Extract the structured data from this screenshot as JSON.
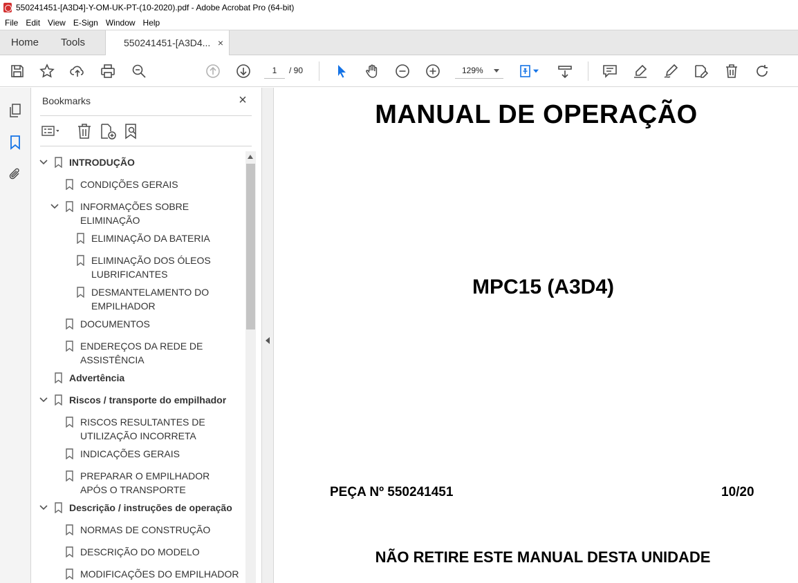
{
  "window": {
    "title": "550241451-[A3D4]-Y-OM-UK-PT-(10-2020).pdf - Adobe Acrobat Pro (64-bit)"
  },
  "menu": [
    "File",
    "Edit",
    "View",
    "E-Sign",
    "Window",
    "Help"
  ],
  "tabs": {
    "home": "Home",
    "tools": "Tools",
    "document": "550241451-[A3D4...",
    "close": "×"
  },
  "toolbar": {
    "page_current": "1",
    "page_total": "/ 90",
    "zoom": "129%",
    "icons": [
      "save-icon",
      "star-icon",
      "upload-icon",
      "print-icon",
      "search-icon",
      "page-up-icon",
      "page-down-icon",
      "select-cursor-icon",
      "hand-icon",
      "zoom-out-icon",
      "zoom-in-icon",
      "fit-page-icon",
      "scroll-mode-icon",
      "comment-icon",
      "highlight-icon",
      "sign-icon",
      "edit-icon",
      "delete-icon",
      "rotate-icon"
    ]
  },
  "colors": {
    "accent": "#1473e6",
    "icon": "#4b4b4b",
    "disabled": "#b3b3b3"
  },
  "bookmarks": {
    "title": "Bookmarks",
    "close": "×",
    "items": [
      {
        "label": "INTRODUÇÃO",
        "bold": true,
        "level": 0,
        "expanded": true
      },
      {
        "label": "CONDIÇÕES GERAIS",
        "bold": false,
        "level": 1
      },
      {
        "label": "INFORMAÇÕES SOBRE ELIMINAÇÃO",
        "bold": false,
        "level": 1,
        "expanded": true
      },
      {
        "label": "ELIMINAÇÃO DA BATERIA",
        "bold": false,
        "level": 2
      },
      {
        "label": "ELIMINAÇÃO DOS ÓLEOS LUBRIFICANTES",
        "bold": false,
        "level": 2
      },
      {
        "label": "DESMANTELAMENTO DO EMPILHADOR",
        "bold": false,
        "level": 2
      },
      {
        "label": "DOCUMENTOS",
        "bold": false,
        "level": 1
      },
      {
        "label": "ENDEREÇOS DA REDE DE ASSISTÊNCIA",
        "bold": false,
        "level": 1
      },
      {
        "label": "Advertência",
        "bold": true,
        "level": 0
      },
      {
        "label": "Riscos / transporte do empilhador",
        "bold": true,
        "level": 0,
        "expanded": true
      },
      {
        "label": "RISCOS RESULTANTES DE UTILIZAÇÃO INCORRETA",
        "bold": false,
        "level": 1
      },
      {
        "label": "INDICAÇÕES GERAIS",
        "bold": false,
        "level": 1
      },
      {
        "label": "PREPARAR O EMPILHADOR APÓS O TRANSPORTE",
        "bold": false,
        "level": 1
      },
      {
        "label": "Descrição / instruções de operação",
        "bold": true,
        "level": 0,
        "expanded": true
      },
      {
        "label": "NORMAS DE CONSTRUÇÃO",
        "bold": false,
        "level": 1
      },
      {
        "label": "DESCRIÇÃO DO MODELO",
        "bold": false,
        "level": 1
      },
      {
        "label": "MODIFICAÇÕES DO EMPILHADOR",
        "bold": false,
        "level": 1
      }
    ]
  },
  "document": {
    "title": "MANUAL DE OPERAÇÃO",
    "model": "MPC15 (A3D4)",
    "part": "PEÇA Nº 550241451",
    "date": "10/20",
    "warning": "NÃO RETIRE ESTE MANUAL DESTA UNIDADE"
  }
}
